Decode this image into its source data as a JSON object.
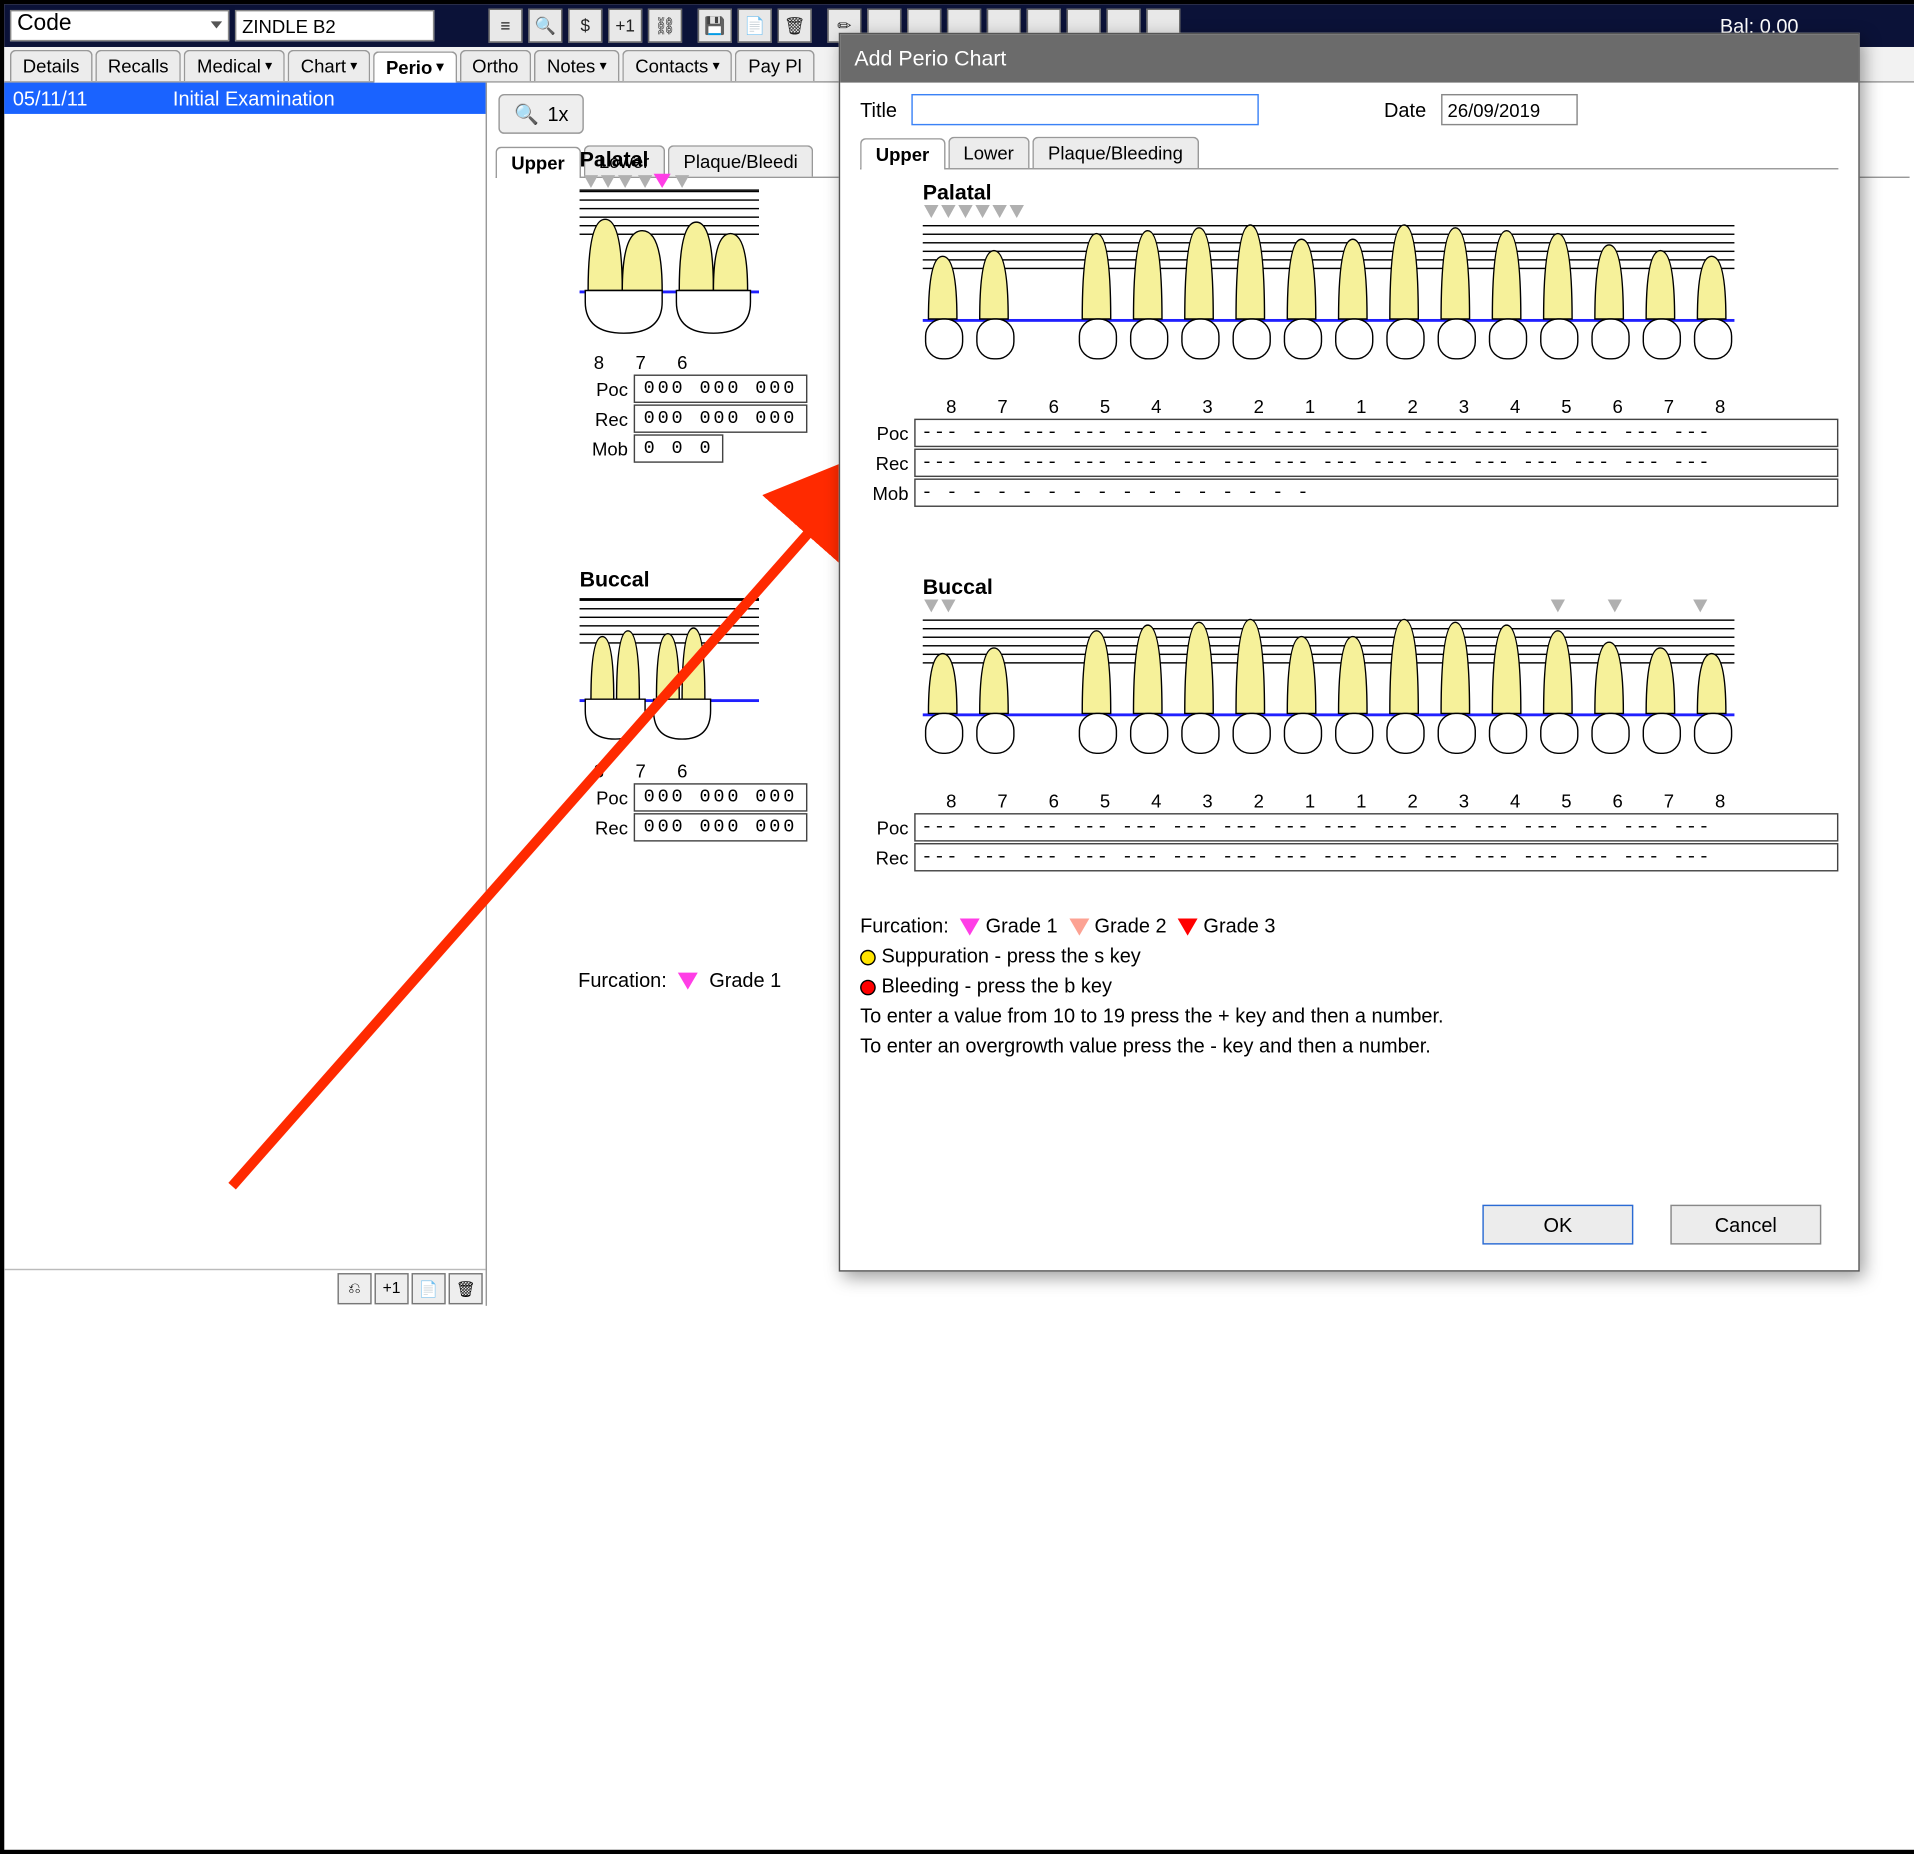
{
  "topbar": {
    "code_label": "Code",
    "name_value": "ZINDLE B2",
    "buttons": [
      "≡",
      "🔍",
      "$",
      "+1",
      "⛓",
      "💾",
      "📄",
      "🗑",
      "✏",
      "…",
      "…",
      "…",
      "…",
      "…",
      "…",
      "…",
      "…"
    ],
    "balance": "Bal: 0.00"
  },
  "tabs": {
    "items": [
      "Details",
      "Recalls",
      "Medical",
      "Chart",
      "Perio",
      "Ortho",
      "Notes",
      "Contacts",
      "Pay Pl"
    ],
    "active": 4
  },
  "leftlist": {
    "date": "05/11/11",
    "title": "Initial Examination"
  },
  "leftbuttons": [
    "⎌",
    "+1",
    "📄",
    "🗑"
  ],
  "zoom": {
    "icon": "🔍",
    "label": "1x"
  },
  "subtabs": {
    "items": [
      "Upper",
      "Lower",
      "Plaque/Bleedi"
    ],
    "active": 0
  },
  "back": {
    "palatal_label": "Palatal",
    "buccal_label": "Buccal",
    "nums": [
      "8",
      "7",
      "6"
    ],
    "poc_label": "Poc",
    "rec_label": "Rec",
    "mob_label": "Mob",
    "poc": "000  000   000",
    "rec": "000  000   000",
    "mob": " 0     0      0",
    "poc2": "000  000   000",
    "rec2": "000  000   000",
    "furc_label": "Furcation:",
    "g1": "Grade 1"
  },
  "modal": {
    "title": "Add Perio Chart",
    "title_label": "Title",
    "title_value": "",
    "date_label": "Date",
    "date_value": "26/09/2019",
    "subtabs": [
      "Upper",
      "Lower",
      "Plaque/Bleeding"
    ],
    "palatal": "Palatal",
    "buccal": "Buccal",
    "nums": [
      "8",
      "7",
      "6",
      "5",
      "4",
      "3",
      "2",
      "1",
      "1",
      "2",
      "3",
      "4",
      "5",
      "6",
      "7",
      "8"
    ],
    "poc_label": "Poc",
    "rec_label": "Rec",
    "mob_label": "Mob",
    "dash_row": "---   ---    ---    ---   ---   ---  ---   ---    ---   ---  ---   ---   ---    ---   ---   ---",
    "mob_row": "  -      -       -       -      -      -     -      -       -      -     -      -      -       -      -      -",
    "furc_label": "Furcation:",
    "g1": "Grade 1",
    "g2": "Grade 2",
    "g3": "Grade 3",
    "supp": "Suppuration - press the s key",
    "bleed": "Bleeding - press the b key",
    "help1": "To enter a value from 10 to 19 press the + key and then a number.",
    "help2": "To enter an overgrowth value press the - key and then a number.",
    "ok": "OK",
    "cancel": "Cancel"
  }
}
